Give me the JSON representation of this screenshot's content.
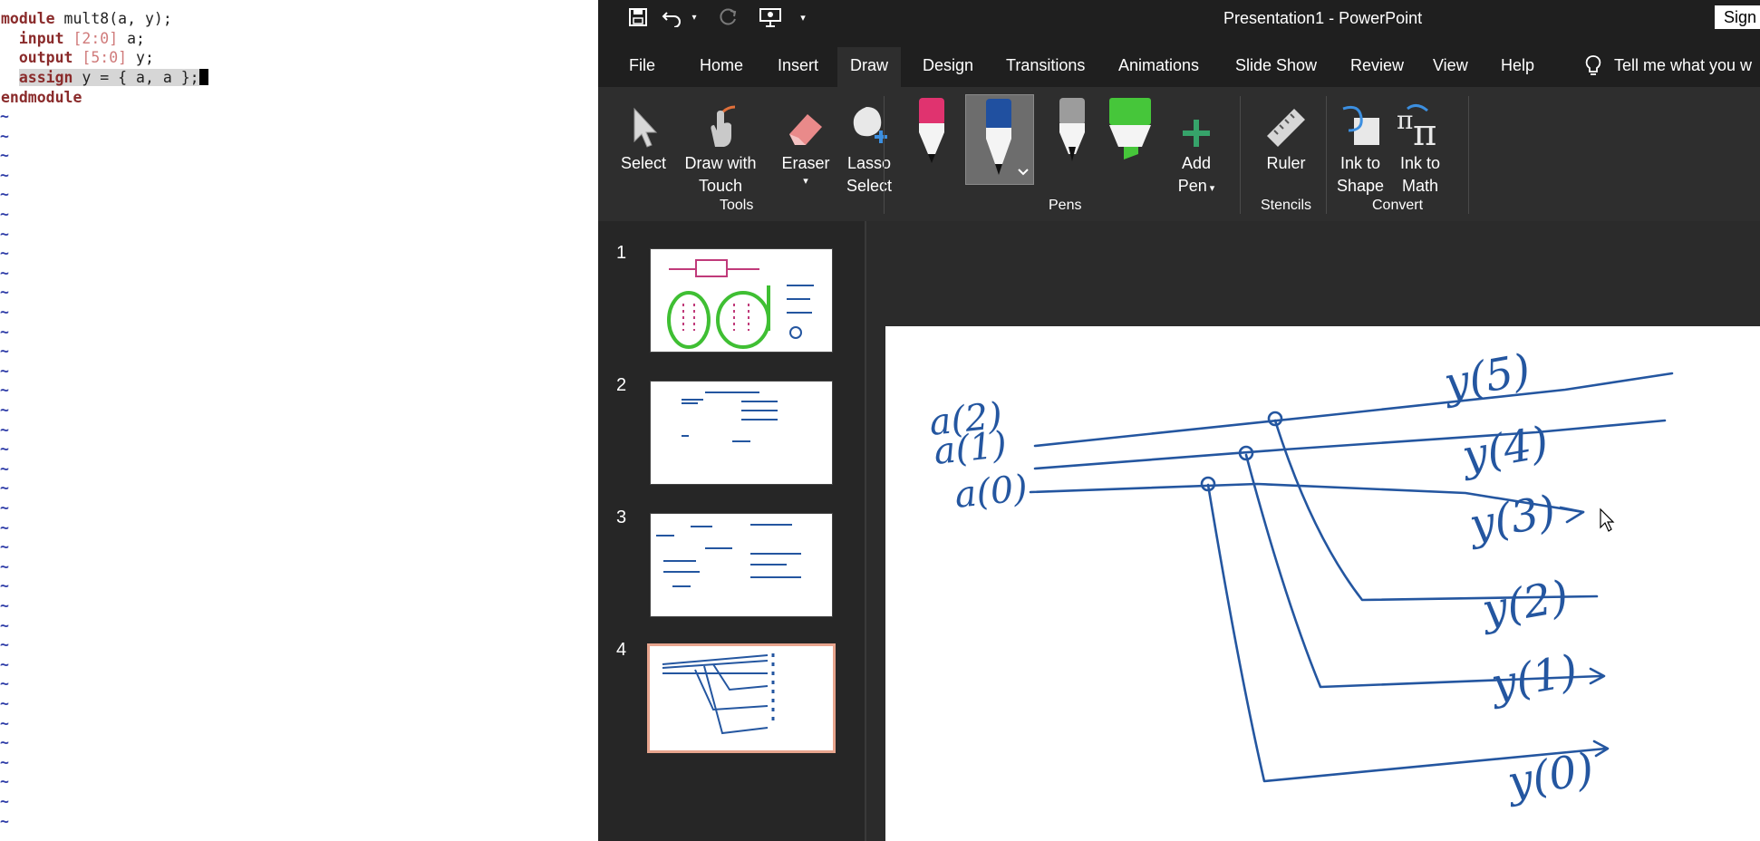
{
  "vim": {
    "line1": {
      "kw": "module",
      "rest": " mult8(a, y);"
    },
    "line2": {
      "indent": "  ",
      "kw": "input",
      "num": " [2:0]",
      "rest": " a;"
    },
    "line3": {
      "indent": "  ",
      "kw": "output",
      "num": " [5:0]",
      "rest": " y;"
    },
    "line4": {
      "indent": "  ",
      "kw": "assign",
      "rest": " y = { a, a };"
    },
    "line5": {
      "kw": "endmodule"
    },
    "tilde_char": "~",
    "tilde_count": 37
  },
  "ppt": {
    "title": "Presentation1  -  PowerPoint",
    "sign_in": "Sign",
    "quick_access": [
      "save-icon",
      "undo-icon",
      "undo-dropdown-icon",
      "redo-icon",
      "start-from-beginning-icon",
      "customize-qat-icon"
    ],
    "tabs": [
      "File",
      "Home",
      "Insert",
      "Draw",
      "Design",
      "Transitions",
      "Animations",
      "Slide Show",
      "Review",
      "View",
      "Help"
    ],
    "active_tab": "Draw",
    "tell_me": "Tell me what you w",
    "ribbon": {
      "select": "Select",
      "draw_touch_1": "Draw with",
      "draw_touch_2": "Touch",
      "eraser": "Eraser",
      "lasso_1": "Lasso",
      "lasso_2": "Select",
      "add_pen_1": "Add",
      "add_pen_2": "Pen",
      "ruler": "Ruler",
      "ink_shape_1": "Ink to",
      "ink_shape_2": "Shape",
      "ink_math_1": "Ink to",
      "ink_math_2": "Math",
      "groups": {
        "tools": "Tools",
        "pens": "Pens",
        "stencils": "Stencils",
        "convert": "Convert"
      },
      "pen_colors": [
        "#e0336f",
        "#1f5aa6",
        "#111111",
        "#46c63a"
      ]
    },
    "slides": [
      "1",
      "2",
      "3",
      "4"
    ],
    "selected_slide": "4",
    "ink_color": "#2456a0",
    "slide_labels": {
      "a2": "a(2)",
      "a1": "a(1)",
      "a0": "a(0)",
      "y5": "y(5)",
      "y4": "y(4)",
      "y3": "y(3)",
      "y2": "y(2)",
      "y1": "y(1)",
      "y0": "y(0)"
    }
  }
}
